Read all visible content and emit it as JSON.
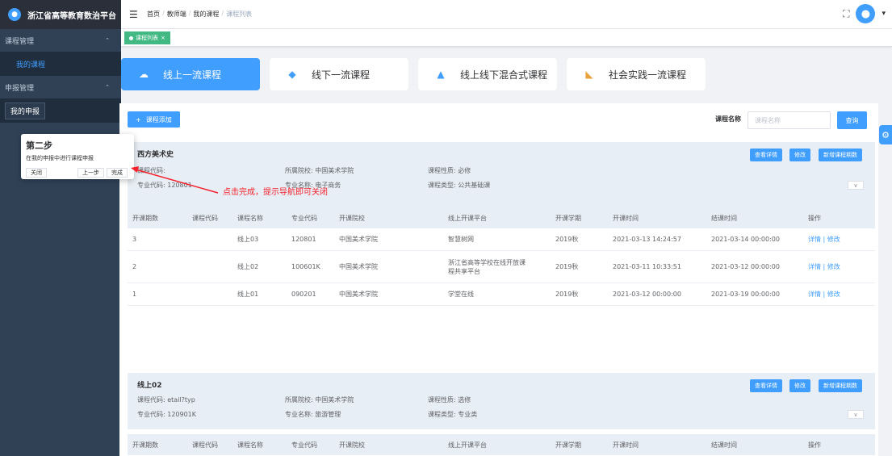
{
  "app": {
    "title": "浙江省高等教育数治平台"
  },
  "sidebar": {
    "groups": [
      {
        "title": "课程管理",
        "items": [
          "我的课程"
        ]
      },
      {
        "title": "申报管理",
        "items": [
          "我的申报"
        ]
      }
    ]
  },
  "breadcrumb": [
    "首页",
    "教师端",
    "我的课程",
    "课程列表"
  ],
  "tag": "课程列表",
  "categories": [
    "线上一流课程",
    "线下一流课程",
    "线上线下混合式课程",
    "社会实践一流课程"
  ],
  "toolbar": {
    "add_label": "课程添加",
    "search_label": "课程名称",
    "search_placeholder": "课程名称",
    "search_button": "查询"
  },
  "tour": {
    "title": "第二步",
    "text": "在我的申报中进行课程申报",
    "close": "关闭",
    "prev": "上一步",
    "done": "完成"
  },
  "hint": "点击完成，提示导航即可关闭",
  "labels": {
    "code": "课程代码:",
    "school": "所属院校:",
    "nature": "课程性质:",
    "major_code": "专业代码:",
    "major_name": "专业名称:",
    "type": "课程类型:",
    "view": "查看详情",
    "edit": "修改",
    "add_period": "新增课程期数"
  },
  "headers": [
    "开课期数",
    "课程代码",
    "课程名称",
    "专业代码",
    "开课院校",
    "线上开课平台",
    "开课学期",
    "开课时间",
    "结课时间",
    "操作"
  ],
  "courses": [
    {
      "name": "西方美术史",
      "code": "课程代码:",
      "school": "所属院校: 中国美术学院",
      "nature": "课程性质: 必修",
      "major_code": "专业代码: 120801",
      "major_name": "专业名称: 电子商务",
      "type": "课程类型: 公共基础课",
      "rows": [
        {
          "period": "3",
          "code": "",
          "name": "线上03",
          "mcode": "120801",
          "school": "中国美术学院",
          "platform": "智慧树网",
          "term": "2019秋",
          "start": "2021-03-13 14:24:57",
          "end": "2021-03-14 00:00:00",
          "ops": "详情 | 修改"
        },
        {
          "period": "2",
          "code": "",
          "name": "线上02",
          "mcode": "100601K",
          "school": "中国美术学院",
          "platform": "浙江省高等学校在线开放课程共享平台",
          "term": "2019秋",
          "start": "2021-03-11 10:33:51",
          "end": "2021-03-12 00:00:00",
          "ops": "详情 | 修改"
        },
        {
          "period": "1",
          "code": "",
          "name": "线上01",
          "mcode": "090201",
          "school": "中国美术学院",
          "platform": "学堂在线",
          "term": "2019秋",
          "start": "2021-03-12 00:00:00",
          "end": "2021-03-19 00:00:00",
          "ops": "详情 | 修改"
        }
      ]
    },
    {
      "name": "线上02",
      "code": "课程代码: etail?typ",
      "school": "所属院校: 中国美术学院",
      "nature": "课程性质: 选修",
      "major_code": "专业代码: 120901K",
      "major_name": "专业名称: 旅游管理",
      "type": "课程类型: 专业类",
      "rows": []
    }
  ],
  "colors": {
    "primary": "#409eff",
    "sidebar": "#304156",
    "tag": "#42b983",
    "hint": "#f5222d"
  }
}
